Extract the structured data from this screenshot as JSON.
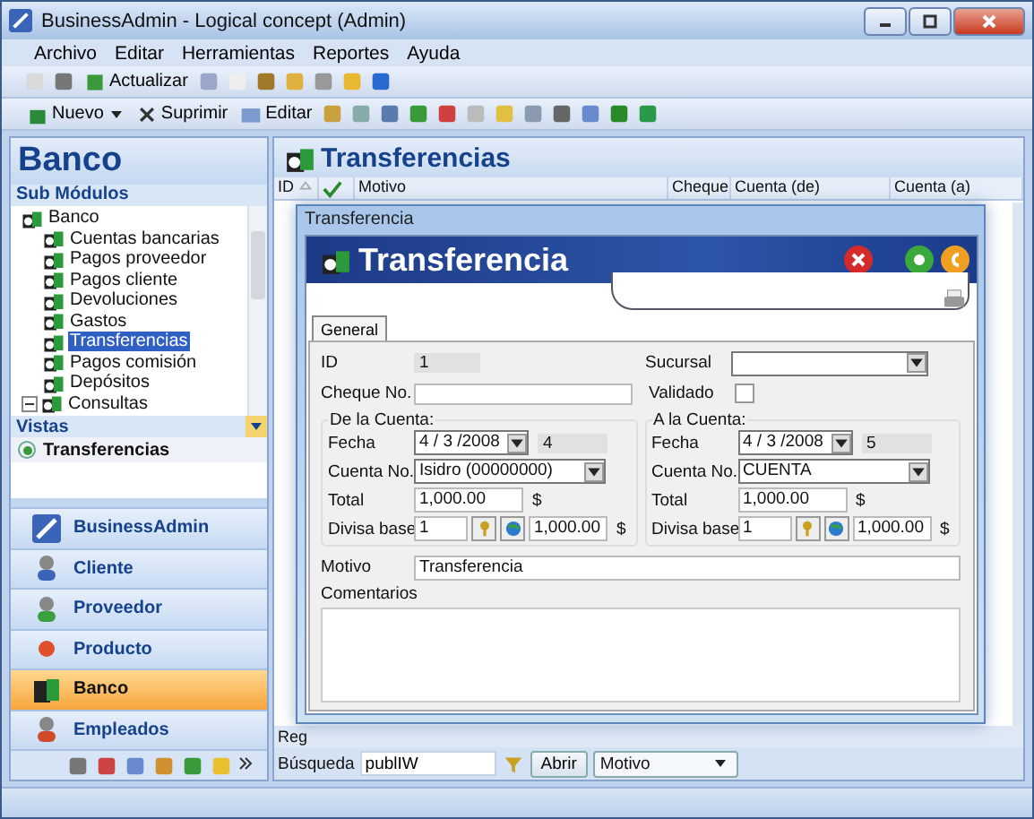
{
  "window": {
    "title": "BusinessAdmin - Logical concept (Admin)"
  },
  "menu": [
    {
      "label": "Archivo"
    },
    {
      "label": "Editar"
    },
    {
      "label": "Herramientas"
    },
    {
      "label": "Reportes"
    },
    {
      "label": "Ayuda"
    }
  ],
  "toolbar_1": {
    "refresh_label": "Actualizar"
  },
  "toolbar_2": {
    "new_label": "Nuevo",
    "delete_label": "Suprimir",
    "edit_label": "Editar"
  },
  "sidebar": {
    "title": "Banco",
    "submodules_label": "Sub Módulos",
    "tree": [
      {
        "label": "Banco",
        "selected": false,
        "children": [
          {
            "label": "Cuentas bancarias",
            "selected": false
          },
          {
            "label": "Pagos proveedor",
            "selected": false
          },
          {
            "label": "Pagos cliente",
            "selected": false
          },
          {
            "label": "Devoluciones",
            "selected": false
          },
          {
            "label": "Gastos",
            "selected": false
          },
          {
            "label": "Transferencias",
            "selected": true
          },
          {
            "label": "Pagos comisión",
            "selected": false
          },
          {
            "label": "Depósitos",
            "selected": false
          },
          {
            "label": "Consultas",
            "selected": false,
            "expanded": true
          }
        ]
      }
    ],
    "views_label": "Vistas",
    "views": [
      {
        "label": "Transferencias",
        "selected": true
      }
    ],
    "modules": [
      {
        "label": "BusinessAdmin",
        "selected": false
      },
      {
        "label": "Cliente",
        "selected": false
      },
      {
        "label": "Proveedor",
        "selected": false
      },
      {
        "label": "Producto",
        "selected": false
      },
      {
        "label": "Banco",
        "selected": true
      },
      {
        "label": "Empleados",
        "selected": false
      }
    ]
  },
  "content": {
    "title": "Transferencias",
    "columns": [
      "ID",
      "Motivo",
      "Cheque",
      "Cuenta (de)",
      "Cuenta (a)"
    ],
    "records_label": "Reg",
    "search_label": "Búsqueda",
    "search_value": "publIW",
    "open_button": "Abrir",
    "search_field": "Motivo"
  },
  "dialog": {
    "title": "Transferencia",
    "banner_title": "Transferencia",
    "tabs": [
      {
        "label": "General",
        "selected": true
      }
    ],
    "id": {
      "label": "ID",
      "value": "1"
    },
    "sucursal": {
      "label": "Sucursal"
    },
    "cheque": {
      "label": "Cheque No."
    },
    "validado": {
      "label": "Validado",
      "checked": false
    },
    "groups": [
      {
        "title": "De la Cuenta:",
        "date_label": "Fecha",
        "date": "4 / 3 /2008",
        "number": "4",
        "account_label": "Cuenta No.",
        "account": "Isidro (00000000)",
        "total_label": "Total",
        "total": "1,000.00",
        "total_currency": "$",
        "base_label": "Divisa base",
        "base": "1",
        "converted": "1,000.00",
        "converted_currency": "$"
      },
      {
        "title": "A la Cuenta:",
        "date_label": "Fecha",
        "date": "4 / 3 /2008",
        "number": "5",
        "account_label": "Cuenta No.",
        "account": "CUENTA",
        "total_label": "Total",
        "total": "1,000.00",
        "total_currency": "$",
        "base_label": "Divisa base",
        "base": "1",
        "converted": "1,000.00",
        "converted_currency": "$"
      }
    ],
    "motivo": {
      "label": "Motivo",
      "value": "Transferencia"
    },
    "comentarios": {
      "label": "Comentarios"
    }
  }
}
